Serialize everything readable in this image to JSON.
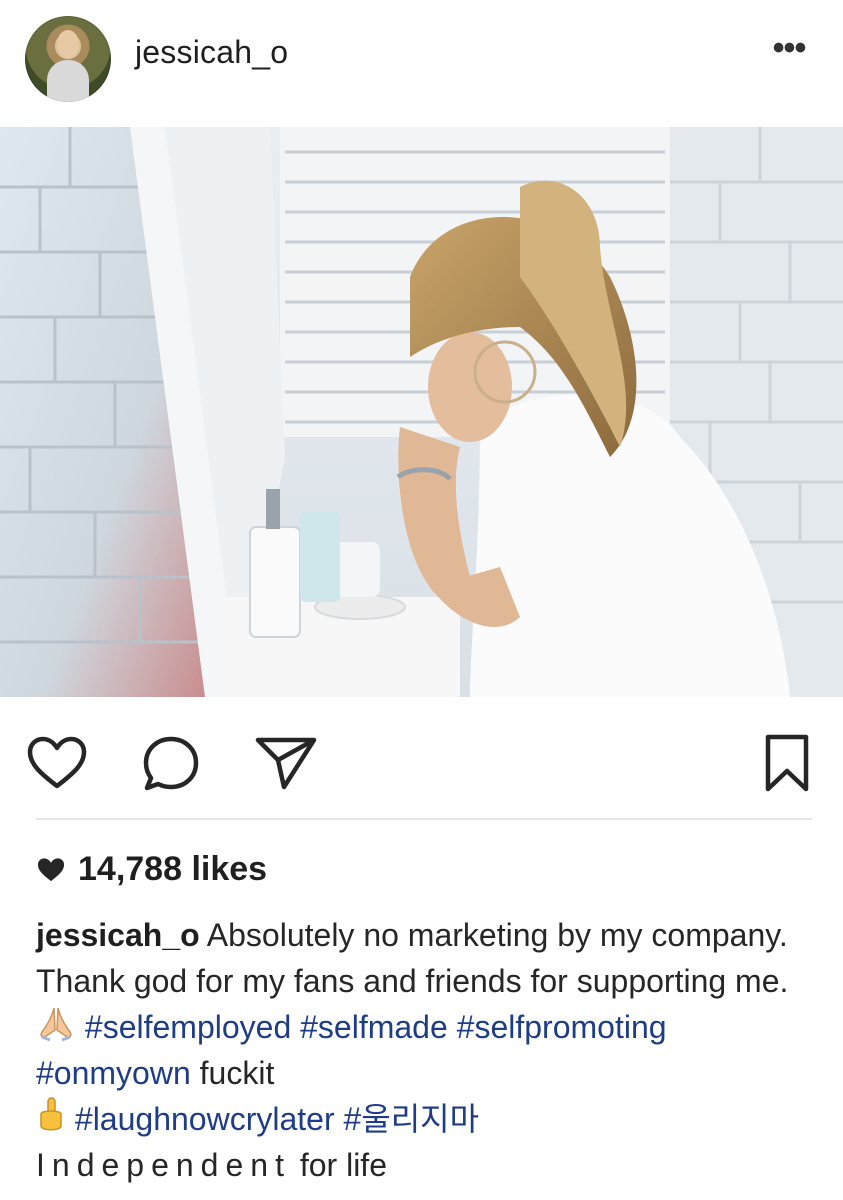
{
  "post": {
    "username": "jessicah_o",
    "more_label": "•••",
    "likes_count": "14,788",
    "likes_suffix": "likes"
  },
  "caption": {
    "username": "jessicah_o",
    "text_1": "Absolutely no marketing by my company. Thank god for my fans and friends for supporting me.",
    "emoji_1": "folded-hands",
    "tag_1": "#selfemployed",
    "tag_2": "#selfmade",
    "tag_3": "#selfpromoting",
    "tag_4": "#onmyown",
    "text_2": "fuckit",
    "emoji_2": "middle-finger",
    "tag_5": "#laughnowcrylater",
    "tag_6": "#울리지마",
    "text_spaced": "Independent",
    "text_3": "for life"
  },
  "icons": {
    "like": "heart-icon",
    "comment": "comment-icon",
    "share": "send-icon",
    "save": "bookmark-icon",
    "likes_heart": "filled-heart-icon"
  },
  "colors": {
    "hashtag": "#1f3c86",
    "text": "#262626"
  }
}
